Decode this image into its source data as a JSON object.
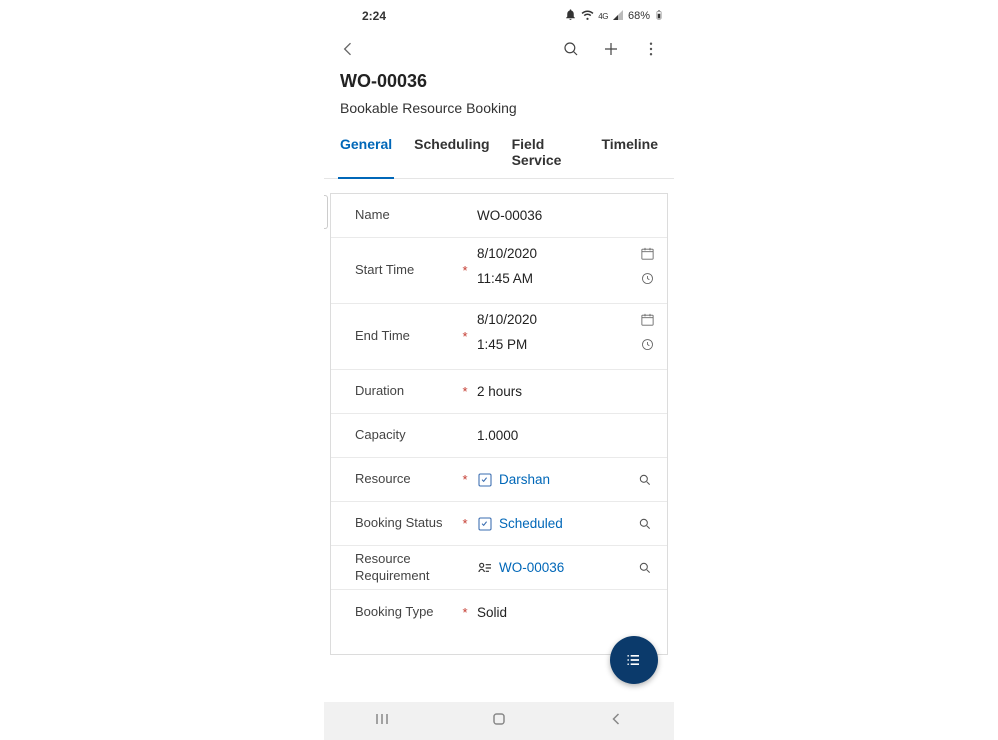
{
  "status": {
    "time": "2:24",
    "battery": "68%"
  },
  "header": {
    "title": "WO-00036",
    "subtitle": "Bookable Resource Booking"
  },
  "tabs": [
    {
      "label": "General",
      "active": true
    },
    {
      "label": "Scheduling",
      "active": false
    },
    {
      "label": "Field Service",
      "active": false
    },
    {
      "label": "Timeline",
      "active": false
    }
  ],
  "form": {
    "name": {
      "label": "Name",
      "value": "WO-00036"
    },
    "start": {
      "label": "Start Time",
      "date": "8/10/2020",
      "time": "11:45 AM"
    },
    "end": {
      "label": "End Time",
      "date": "8/10/2020",
      "time": "1:45 PM"
    },
    "duration": {
      "label": "Duration",
      "value": "2 hours"
    },
    "capacity": {
      "label": "Capacity",
      "value": "1.0000"
    },
    "resource": {
      "label": "Resource",
      "value": "Darshan"
    },
    "bookingStatus": {
      "label": "Booking Status",
      "value": "Scheduled"
    },
    "resourceReq": {
      "label": "Resource Requirement",
      "value": "WO-00036"
    },
    "bookingType": {
      "label": "Booking Type",
      "value": "Solid"
    }
  }
}
